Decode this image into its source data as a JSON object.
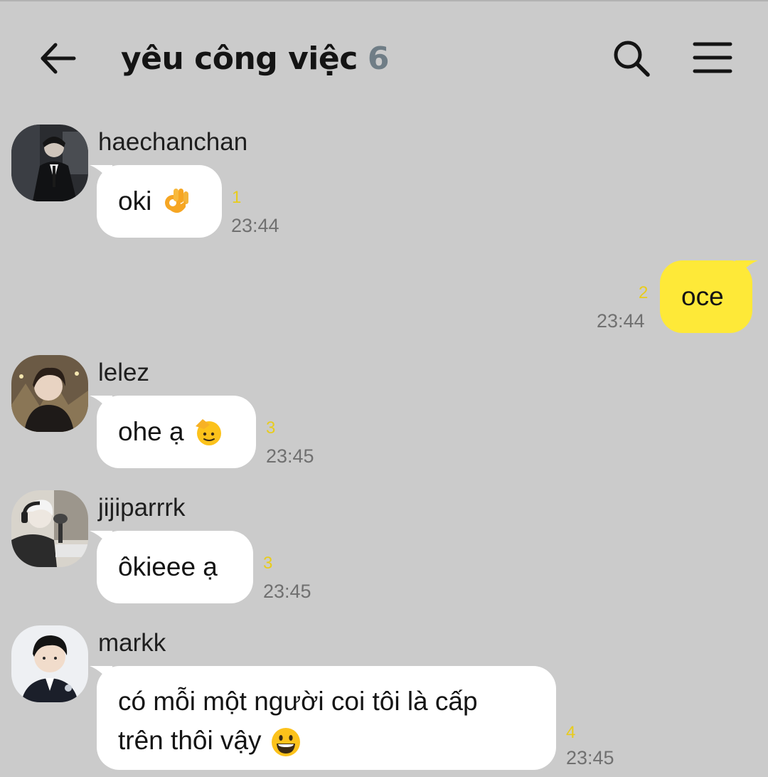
{
  "header": {
    "back_icon": "arrow-left-icon",
    "title": "yêu công việc",
    "member_count": "6",
    "search_icon": "search-icon",
    "menu_icon": "hamburger-menu-icon"
  },
  "colors": {
    "background": "#cbcbcb",
    "incoming_bubble": "#ffffff",
    "outgoing_bubble": "#fee938",
    "unread_count": "#e8cc1c",
    "member_count": "#6f7d86"
  },
  "messages": [
    {
      "sender": "haechanchan",
      "text": "oki",
      "emoji": "ok-hand-emoji",
      "unread": "1",
      "time": "23:44"
    },
    {
      "outgoing": true,
      "text": "oce",
      "unread": "2",
      "time": "23:44"
    },
    {
      "sender": "lelez",
      "text": "ohe ạ",
      "emoji": "saluting-face-emoji",
      "unread": "3",
      "time": "23:45"
    },
    {
      "sender": "jijiparrrk",
      "text": "ôkieee ạ",
      "unread": "3",
      "time": "23:45"
    },
    {
      "sender": "markk",
      "text_lines": [
        "có mỗi một người coi tôi là cấp",
        "trên thôi vậy"
      ],
      "emoji": "grinning-face-emoji",
      "unread": "4",
      "time": "23:45"
    }
  ]
}
